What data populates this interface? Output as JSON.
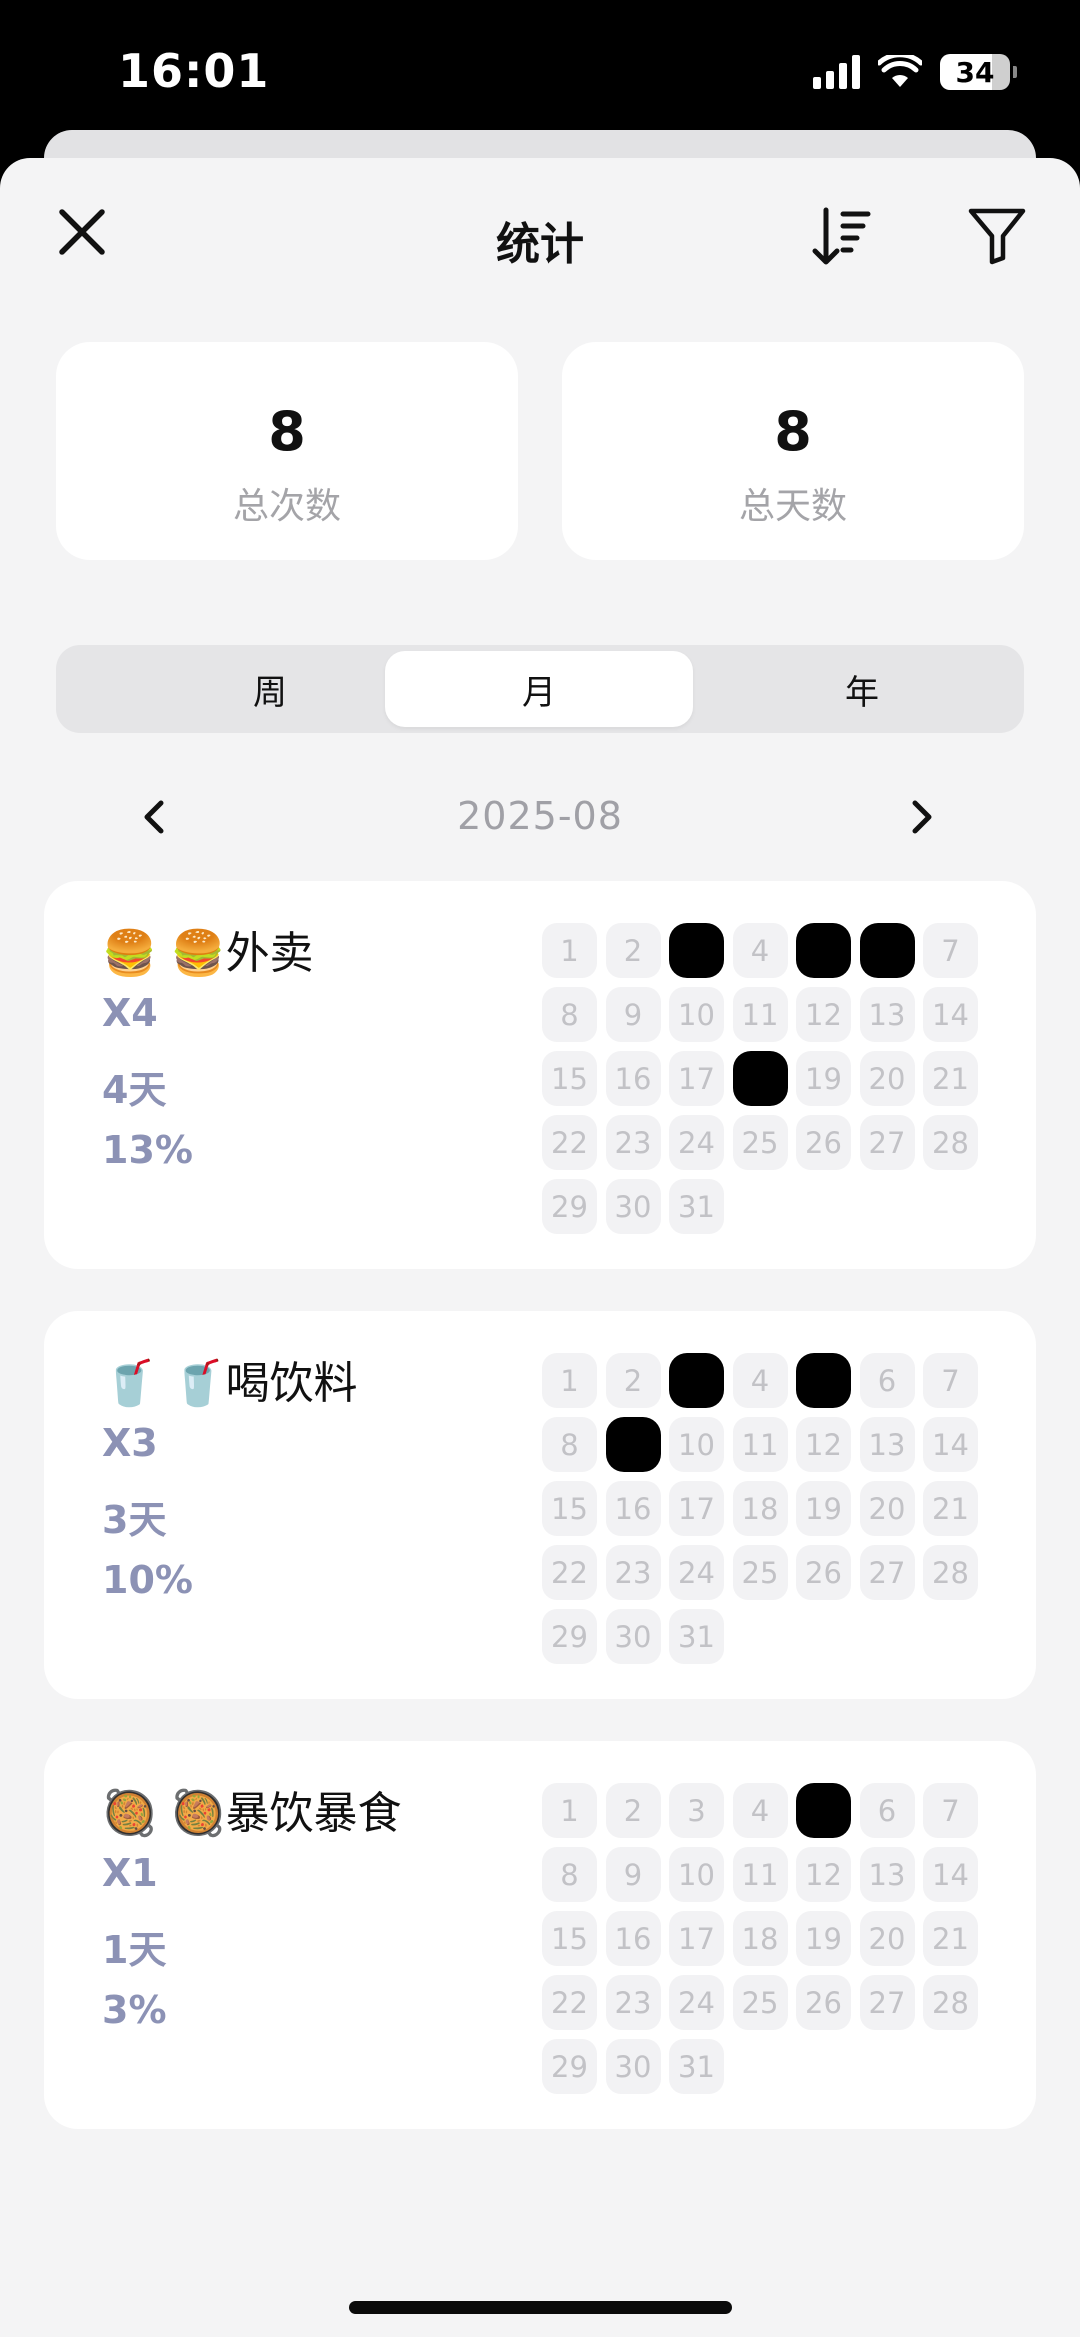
{
  "status_bar": {
    "time": "16:01",
    "battery": "34",
    "battery_level": 0.34
  },
  "header": {
    "title": "统计"
  },
  "summary": [
    {
      "value": "8",
      "label": "总次数"
    },
    {
      "value": "8",
      "label": "总天数"
    }
  ],
  "period_tabs": {
    "items": [
      "周",
      "月",
      "年"
    ],
    "selected": "月"
  },
  "month_nav": {
    "label": "2025-08"
  },
  "habits": [
    {
      "emoji": "🍔 🍔",
      "name": "外卖",
      "count": "X4",
      "days": "4天",
      "percent": "13%",
      "marked_days": [
        3,
        5,
        6,
        18
      ]
    },
    {
      "emoji": "🥤 🥤",
      "name": "喝饮料",
      "count": "X3",
      "days": "3天",
      "percent": "10%",
      "marked_days": [
        3,
        5,
        9
      ]
    },
    {
      "emoji": "🥘 🥘",
      "name": "暴饮暴食",
      "count": "X1",
      "days": "1天",
      "percent": "3%",
      "marked_days": [
        5
      ]
    }
  ],
  "calendar": {
    "days": [
      "1",
      "2",
      "3",
      "4",
      "5",
      "6",
      "7",
      "8",
      "9",
      "10",
      "11",
      "12",
      "13",
      "14",
      "15",
      "16",
      "17",
      "18",
      "19",
      "20",
      "21",
      "22",
      "23",
      "24",
      "25",
      "26",
      "27",
      "28",
      "29",
      "30",
      "31"
    ]
  },
  "colors": {
    "accent_marked": "#000000",
    "stat_text": "#8c92b5",
    "background": "#f4f4f5"
  }
}
